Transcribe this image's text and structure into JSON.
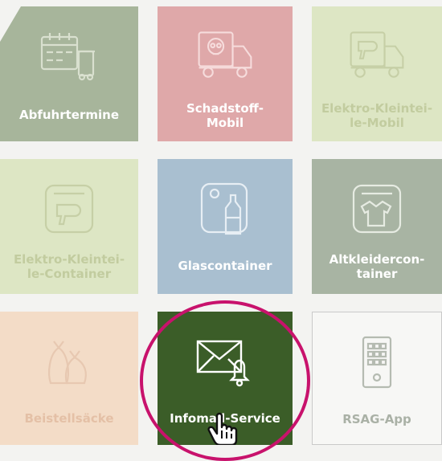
{
  "tiles": [
    {
      "label": "Abfuhrtermine",
      "icon": "calendar-bin-icon"
    },
    {
      "label": "Schadstoff-\nMobil",
      "icon": "skull-truck-icon"
    },
    {
      "label": "Elektro-Kleintei-\nle-Mobil",
      "icon": "hairdryer-truck-icon"
    },
    {
      "label": "Elektro-Kleintei-\nle-Container",
      "icon": "hairdryer-container-icon"
    },
    {
      "label": "Glascontainer",
      "icon": "bottle-container-icon"
    },
    {
      "label": "Altkleidercon-\ntainer",
      "icon": "shirt-container-icon"
    },
    {
      "label": "Beistellsäcke",
      "icon": "bags-icon"
    },
    {
      "label": "Infomail-Service",
      "icon": "mail-bell-icon"
    },
    {
      "label": "RSAG-App",
      "icon": "phone-app-icon"
    }
  ],
  "colors": {
    "highlight_ring": "#c8126c",
    "active_tile": "#3b5d28"
  }
}
